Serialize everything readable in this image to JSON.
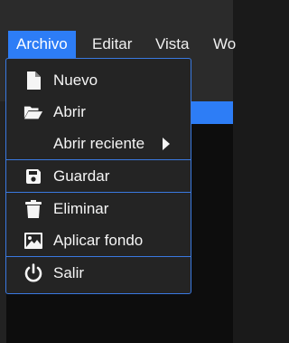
{
  "menubar": {
    "items": [
      {
        "label": "Archivo"
      },
      {
        "label": "Editar"
      },
      {
        "label": "Vista"
      },
      {
        "label": "Wo"
      }
    ]
  },
  "file_menu": {
    "items": [
      {
        "label": "Nuevo",
        "icon": "file-icon"
      },
      {
        "label": "Abrir",
        "icon": "folder-open-icon"
      },
      {
        "label": "Abrir reciente",
        "icon": "none",
        "submenu": true
      },
      {
        "label": "Guardar",
        "icon": "save-icon"
      },
      {
        "label": "Eliminar",
        "icon": "trash-icon"
      },
      {
        "label": "Aplicar fondo",
        "icon": "image-icon"
      },
      {
        "label": "Salir",
        "icon": "power-icon"
      }
    ]
  },
  "colors": {
    "accent": "#2d7df6",
    "menu_border": "#3a79e0",
    "menu_background": "#242424",
    "menubar_background": "#2b2b2b"
  }
}
